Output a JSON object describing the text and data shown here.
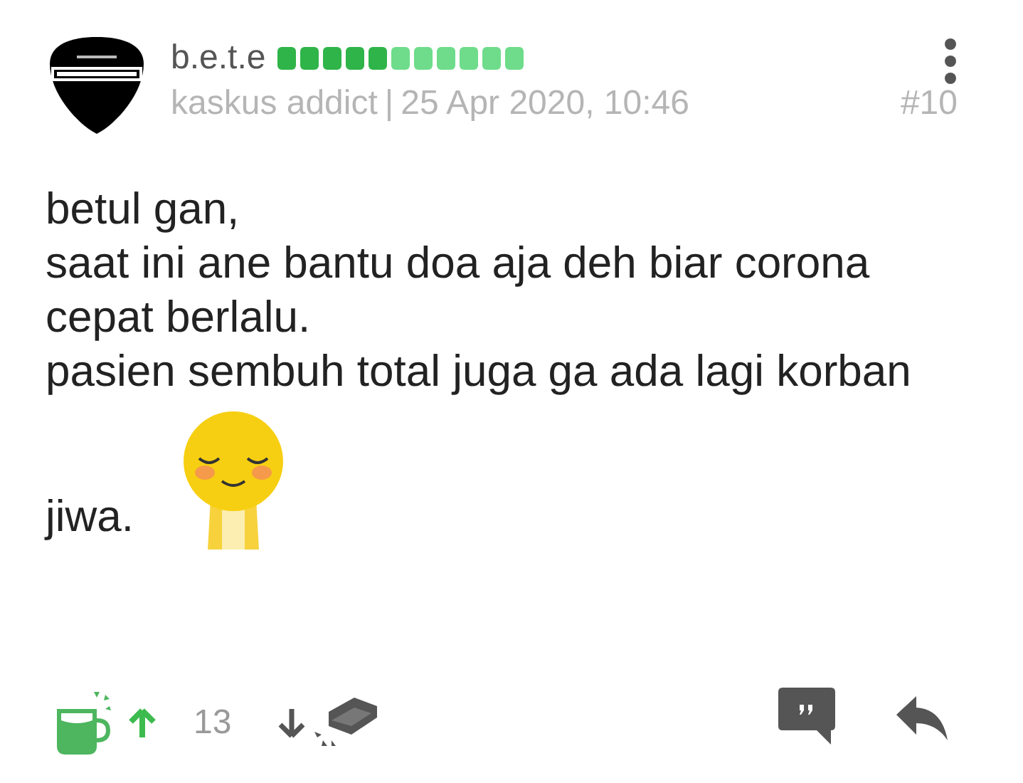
{
  "post": {
    "username": "b.e.t.e",
    "rank": "kaskus addict",
    "separator": "|",
    "date": "25 Apr 2020, 10:46",
    "number": "#10",
    "lines": [
      "betul gan,",
      "saat ini ane bantu doa aja deh biar corona",
      "cepat berlalu.",
      "pasien sembuh total juga ga ada lagi korban",
      "jiwa."
    ],
    "vote_count": "13"
  }
}
